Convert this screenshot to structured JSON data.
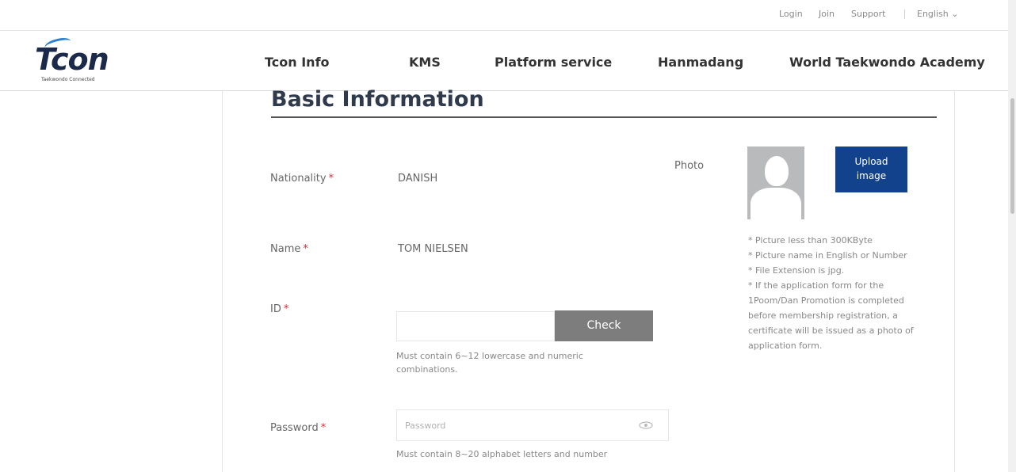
{
  "topbar": {
    "login": "Login",
    "join": "Join",
    "support": "Support",
    "language": "English ⌄"
  },
  "brand": {
    "name": "Tcon",
    "tagline": "Taekwondo Connected",
    "primary_color": "#1b2a4a",
    "accent_color": "#2a7fd4"
  },
  "nav": {
    "items": [
      "Tcon Info",
      "KMS",
      "Platform service",
      "Hanmadang",
      "World Taekwondo Academy"
    ]
  },
  "form": {
    "title": "Basic Information",
    "required_mark": "*",
    "nationality": {
      "label": "Nationality",
      "value": "DANISH"
    },
    "name": {
      "label": "Name",
      "value": "TOM NIELSEN"
    },
    "id": {
      "label": "ID",
      "value": "",
      "check_label": "Check",
      "hint": "Must contain 6~12 lowercase and numeric combinations."
    },
    "password": {
      "label": "Password",
      "placeholder": "Password",
      "toggle_icon": "eye-icon",
      "hint": "Must contain 8~20 alphabet letters and number"
    },
    "photo": {
      "label": "Photo",
      "upload_line1": "Upload",
      "upload_line2": "image",
      "upload_color": "#12428b",
      "notes": [
        "* Picture less than 300KByte",
        "* Picture name in English or Number",
        "* File Extension is jpg.",
        "* If the application form for the 1Poom/Dan Promotion is completed before membership registration, a certificate will be issued as a photo of application form."
      ]
    }
  }
}
